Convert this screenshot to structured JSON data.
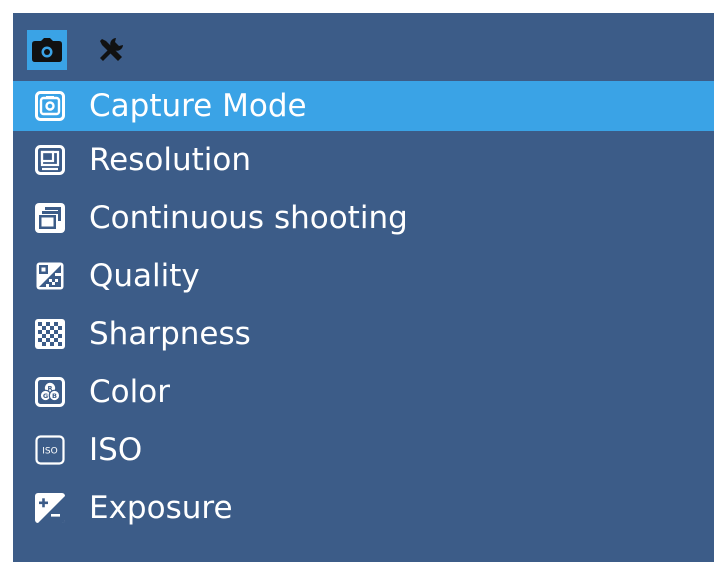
{
  "tabs": [
    {
      "icon": "camera-icon",
      "active": true
    },
    {
      "icon": "tools-icon",
      "active": false
    }
  ],
  "menu": {
    "items": [
      {
        "label": "Capture Mode",
        "icon": "capture-mode-icon",
        "selected": true
      },
      {
        "label": "Resolution",
        "icon": "resolution-icon",
        "selected": false
      },
      {
        "label": "Continuous shooting",
        "icon": "continuous-shooting-icon",
        "selected": false
      },
      {
        "label": "Quality",
        "icon": "quality-icon",
        "selected": false
      },
      {
        "label": "Sharpness",
        "icon": "sharpness-icon",
        "selected": false
      },
      {
        "label": "Color",
        "icon": "color-icon",
        "selected": false
      },
      {
        "label": "ISO",
        "icon": "iso-icon",
        "selected": false
      },
      {
        "label": "Exposure",
        "icon": "exposure-icon",
        "selected": false
      }
    ],
    "iso_icon_text": "ISO",
    "color_icon_letters": [
      "R",
      "G",
      "B"
    ]
  },
  "colors": {
    "background": "#3c5c88",
    "highlight": "#3aa3e6",
    "text": "#ffffff",
    "page": "#ffffff"
  }
}
